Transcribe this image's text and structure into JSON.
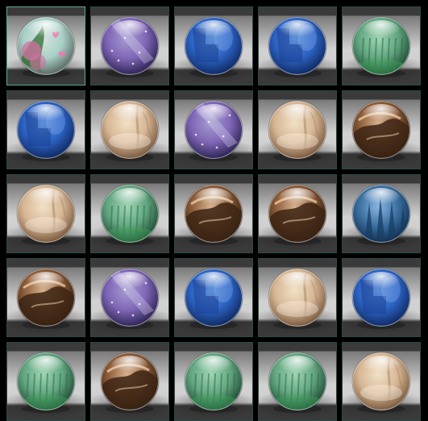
{
  "title": "",
  "board": {
    "rows": 5,
    "cols": 5,
    "selected": [
      0,
      0
    ],
    "tiles": [
      [
        "blossom",
        "nebula",
        "ocean",
        "ocean",
        "jade"
      ],
      [
        "ocean",
        "sand",
        "nebula",
        "sand",
        "ember"
      ],
      [
        "sand",
        "jade",
        "ember",
        "ember",
        "pine"
      ],
      [
        "ember",
        "nebula",
        "ocean",
        "sand",
        "ocean"
      ],
      [
        "jade",
        "ember",
        "jade",
        "jade",
        "sand"
      ]
    ]
  },
  "orbs": {
    "blossom": {
      "icon": "blossom-orb-icon",
      "base": "#d7e2df",
      "mid": "#a8d0c8",
      "dark": "#5b6a62",
      "accent": "#d46fa0",
      "accent2": "#2c6d32"
    },
    "nebula": {
      "icon": "nebula-orb-icon",
      "base": "#a69cd0",
      "mid": "#7f66b6",
      "dark": "#2e2455",
      "accent": "#d6d2f1",
      "accent2": "#4f3b8f"
    },
    "ocean": {
      "icon": "ocean-orb-icon",
      "base": "#5e8fd6",
      "mid": "#2c63c3",
      "dark": "#102a63",
      "accent": "#a8c8ff",
      "accent2": "#1b3f94"
    },
    "jade": {
      "icon": "jade-orb-icon",
      "base": "#9fd5b3",
      "mid": "#63a681",
      "dark": "#1f4a34",
      "accent": "#e0ffea",
      "accent2": "#2f6d4b"
    },
    "sand": {
      "icon": "sand-orb-icon",
      "base": "#f1e1c6",
      "mid": "#d7b795",
      "dark": "#7a5a3f",
      "accent": "#fff6ea",
      "accent2": "#9c7a5b"
    },
    "ember": {
      "icon": "ember-orb-icon",
      "base": "#d9b28e",
      "mid": "#8a5a36",
      "dark": "#2c1a0e",
      "accent": "#f7d6b4",
      "accent2": "#3c2414"
    },
    "pine": {
      "icon": "pine-orb-icon",
      "base": "#89b6e3",
      "mid": "#3a6fa0",
      "dark": "#122e4f",
      "accent": "#cfe8ff",
      "accent2": "#173e63"
    }
  }
}
